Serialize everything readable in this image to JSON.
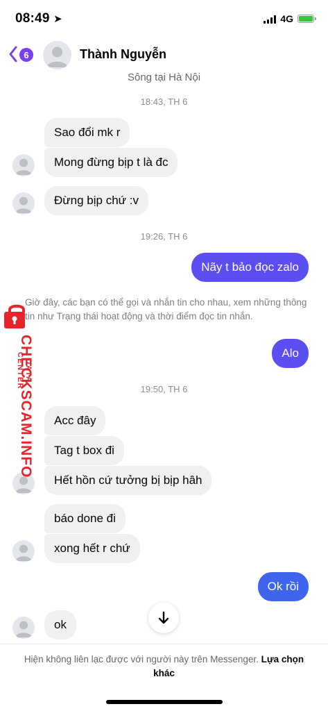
{
  "status_bar": {
    "time": "08:49",
    "network": "4G"
  },
  "header": {
    "back_badge": "6",
    "contact_name": "Thành Nguyễn",
    "subtitle": "Sông tại Hà Nội"
  },
  "timestamps": [
    "18:43, TH 6",
    "19:26, TH 6",
    "19:50, TH 6"
  ],
  "messages": [
    {
      "text": "Sao đổi mk r",
      "direction": "in"
    },
    {
      "text": "Mong đừng bịp t là đc",
      "direction": "in"
    },
    {
      "text": "Đừng bịp chứ :v",
      "direction": "in"
    },
    {
      "text": "Nãy t bảo đọc zalo",
      "direction": "out"
    },
    {
      "text": "Alo",
      "direction": "out"
    },
    {
      "text": "Acc đây",
      "direction": "in"
    },
    {
      "text": "Tag t box đi",
      "direction": "in"
    },
    {
      "text": "Hết hồn cứ tưởng bị bịp hâh",
      "direction": "in"
    },
    {
      "text": "báo done đi",
      "direction": "in"
    },
    {
      "text": "xong hết r chứ",
      "direction": "in"
    },
    {
      "text": "Ok rồi",
      "direction": "out"
    },
    {
      "text": "ok",
      "direction": "in"
    }
  ],
  "notice": "Giờ đây, các bạn có thể gọi và nhắn tin cho nhau, xem những thông tin như Trạng thái hoạt động và thời điểm đọc tin nhắn.",
  "watermark": {
    "main": "CHECKSCAM.INFO",
    "sub": "DATA CENTER"
  },
  "footer": {
    "text": "Hiện không liên lạc được với người này trên Messenger.",
    "link": "Lựa chọn khác"
  },
  "colors": {
    "accent": "#7b3ff2",
    "outgoing_bubble": "#5b4ff2",
    "outgoing_bubble_latest": "#3f64ee",
    "incoming_bubble": "#f0f0f0",
    "watermark": "#e8232a"
  }
}
